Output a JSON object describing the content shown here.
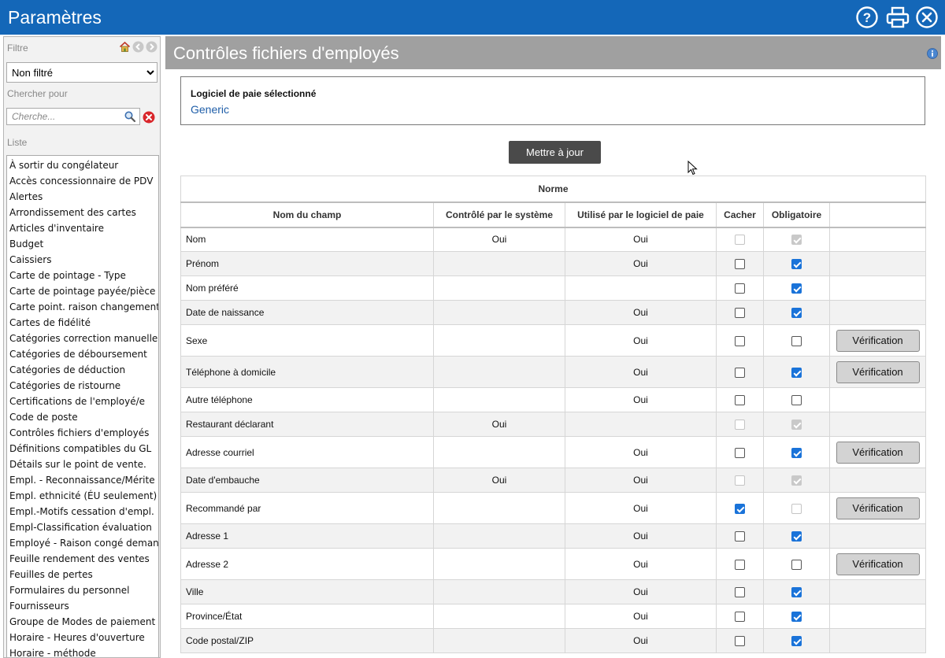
{
  "window": {
    "title": "Paramètres"
  },
  "sidebar": {
    "filter_label": "Filtre",
    "filter_value": "Non filtré",
    "search_label": "Chercher pour",
    "search_placeholder": "Cherche...",
    "list_label": "Liste",
    "items": [
      "À sortir du congélateur",
      "Accès concessionnaire de PDV",
      "Alertes",
      "Arrondissement des cartes",
      "Articles d'inventaire",
      "Budget",
      "Caissiers",
      "Carte de pointage - Type",
      "Carte de pointage payée/pièce",
      "Carte point. raison changement",
      "Cartes de fidélité",
      "Catégories correction manuelle",
      "Catégories de déboursement",
      "Catégories de déduction",
      "Catégories de ristourne",
      "Certifications de l'employé/e",
      "Code de poste",
      "Contrôles fichiers d'employés",
      "Définitions compatibles du GL",
      "Détails sur le point de vente.",
      "Empl. - Reconnaissance/Mérite",
      "Empl. ethnicité (ÉU seulement)",
      "Empl.-Motifs cessation d'empl.",
      "Empl-Classification évaluation",
      "Employé - Raison congé demand",
      "Feuille rendement des ventes",
      "Feuilles de pertes",
      "Formulaires du personnel",
      "Fournisseurs",
      "Groupe de Modes de paiement",
      "Horaire - Heures d'ouverture",
      "Horaire - méthode"
    ]
  },
  "main": {
    "title": "Contrôles fichiers d'employés",
    "payroll_label": "Logiciel de paie sélectionné",
    "payroll_value": "Generic",
    "update_button": "Mettre à jour",
    "verif_label": "Vérification",
    "table": {
      "group_header": "Norme",
      "columns": [
        "Nom du champ",
        "Contrôlé par le système",
        "Utilisé par le logiciel de paie",
        "Cacher",
        "Obligatoire"
      ],
      "rows": [
        {
          "name": "Nom",
          "system": "Oui",
          "payroll": "Oui",
          "hide": false,
          "hide_disabled": true,
          "required": true,
          "required_disabled": true,
          "verif": false
        },
        {
          "name": "Prénom",
          "system": "",
          "payroll": "Oui",
          "hide": false,
          "hide_disabled": false,
          "required": true,
          "required_disabled": false,
          "verif": false
        },
        {
          "name": "Nom préféré",
          "system": "",
          "payroll": "",
          "hide": false,
          "hide_disabled": false,
          "required": true,
          "required_disabled": false,
          "verif": false
        },
        {
          "name": "Date de naissance",
          "system": "",
          "payroll": "Oui",
          "hide": false,
          "hide_disabled": false,
          "required": true,
          "required_disabled": false,
          "verif": false
        },
        {
          "name": "Sexe",
          "system": "",
          "payroll": "Oui",
          "hide": false,
          "hide_disabled": false,
          "required": false,
          "required_disabled": false,
          "verif": true
        },
        {
          "name": "Téléphone à domicile",
          "system": "",
          "payroll": "Oui",
          "hide": false,
          "hide_disabled": false,
          "required": true,
          "required_disabled": false,
          "verif": true
        },
        {
          "name": "Autre téléphone",
          "system": "",
          "payroll": "Oui",
          "hide": false,
          "hide_disabled": false,
          "required": false,
          "required_disabled": false,
          "verif": false
        },
        {
          "name": "Restaurant déclarant",
          "system": "Oui",
          "payroll": "",
          "hide": false,
          "hide_disabled": true,
          "required": true,
          "required_disabled": true,
          "verif": false
        },
        {
          "name": "Adresse courriel",
          "system": "",
          "payroll": "Oui",
          "hide": false,
          "hide_disabled": false,
          "required": true,
          "required_disabled": false,
          "verif": true
        },
        {
          "name": "Date d'embauche",
          "system": "Oui",
          "payroll": "Oui",
          "hide": false,
          "hide_disabled": true,
          "required": true,
          "required_disabled": true,
          "verif": false
        },
        {
          "name": "Recommandé par",
          "system": "",
          "payroll": "Oui",
          "hide": true,
          "hide_disabled": false,
          "required": false,
          "required_disabled": true,
          "verif": true
        },
        {
          "name": "Adresse 1",
          "system": "",
          "payroll": "Oui",
          "hide": false,
          "hide_disabled": false,
          "required": true,
          "required_disabled": false,
          "verif": false
        },
        {
          "name": "Adresse 2",
          "system": "",
          "payroll": "Oui",
          "hide": false,
          "hide_disabled": false,
          "required": false,
          "required_disabled": false,
          "verif": true
        },
        {
          "name": "Ville",
          "system": "",
          "payroll": "Oui",
          "hide": false,
          "hide_disabled": false,
          "required": true,
          "required_disabled": false,
          "verif": false
        },
        {
          "name": "Province/État",
          "system": "",
          "payroll": "Oui",
          "hide": false,
          "hide_disabled": false,
          "required": true,
          "required_disabled": false,
          "verif": false
        },
        {
          "name": "Code postal/ZIP",
          "system": "",
          "payroll": "Oui",
          "hide": false,
          "hide_disabled": false,
          "required": true,
          "required_disabled": false,
          "verif": false
        }
      ]
    }
  },
  "colors": {
    "title_bar": "#1467b8",
    "header_bar": "#a0a0a0",
    "accent": "#1a73d9",
    "link": "#1f5ea8"
  },
  "icons": {
    "help": "help-icon",
    "print": "print-icon",
    "close": "close-icon",
    "home": "home-icon",
    "back": "back-icon",
    "forward": "forward-icon",
    "search": "search-icon",
    "clear": "clear-icon",
    "info": "info-icon"
  }
}
